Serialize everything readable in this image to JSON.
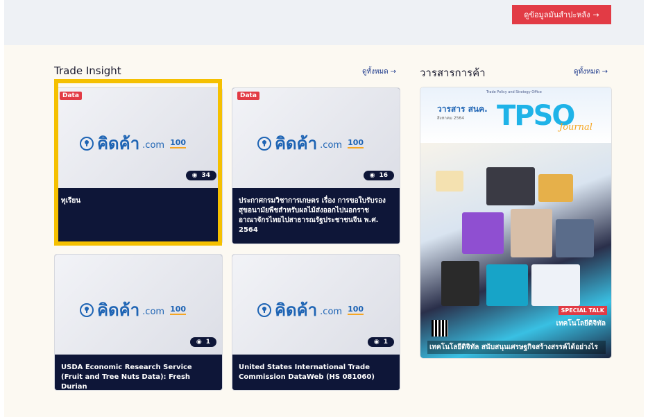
{
  "header": {
    "cta_label": "ดูข้อมูลมันสำปะหลัง",
    "cta_arrow": "→"
  },
  "trade_insight": {
    "title": "Trade Insight",
    "see_all": "ดูทั้งหมด",
    "see_all_arrow": "→",
    "cards": [
      {
        "tag": "Data",
        "brand": "คิดค้า",
        "brand_suffix": ".com",
        "badge": "100",
        "views": "34",
        "title": "ทุเรียน"
      },
      {
        "tag": "Data",
        "brand": "คิดค้า",
        "brand_suffix": ".com",
        "badge": "100",
        "views": "16",
        "title": "ประกาศกรมวิชาการเกษตร เรื่อง การขอใบรับรองสุขอนามัยพืชสำหรับผลไม้ส่งออกไปนอกราชอาณาจักรไทยไปสาธารณรัฐประชาชนจีน พ.ศ. 2564"
      },
      {
        "tag": "",
        "brand": "คิดค้า",
        "brand_suffix": ".com",
        "badge": "100",
        "views": "1",
        "title": "USDA Economic Research Service (Fruit and Tree Nuts Data): Fresh Durian"
      },
      {
        "tag": "",
        "brand": "คิดค้า",
        "brand_suffix": ".com",
        "badge": "100",
        "views": "1",
        "title": "United States International Trade Commission DataWeb (HS 081060)"
      }
    ]
  },
  "journal": {
    "title": "วารสารการค้า",
    "see_all": "ดูทั้งหมด",
    "see_all_arrow": "→",
    "cover": {
      "small_title": "วารสาร สนค.",
      "small_sub": "สิงหาคม 2564",
      "office": "Trade Policy and Strategy Office",
      "brand": "TPSO",
      "journal_word": "Journal",
      "special_label": "SPECIAL TALK",
      "special_title": "เทคโนโลยีดิจิทัล",
      "caption": "เทคโนโลยีดิจิทัล สนับสนุนเศรษฐกิจสร้างสรรค์ได้อย่างไร"
    }
  },
  "colors": {
    "accent_red": "#e23b45",
    "card_dark": "#0e1638",
    "highlight": "#f5c000",
    "brand_blue": "#1e64b4"
  }
}
